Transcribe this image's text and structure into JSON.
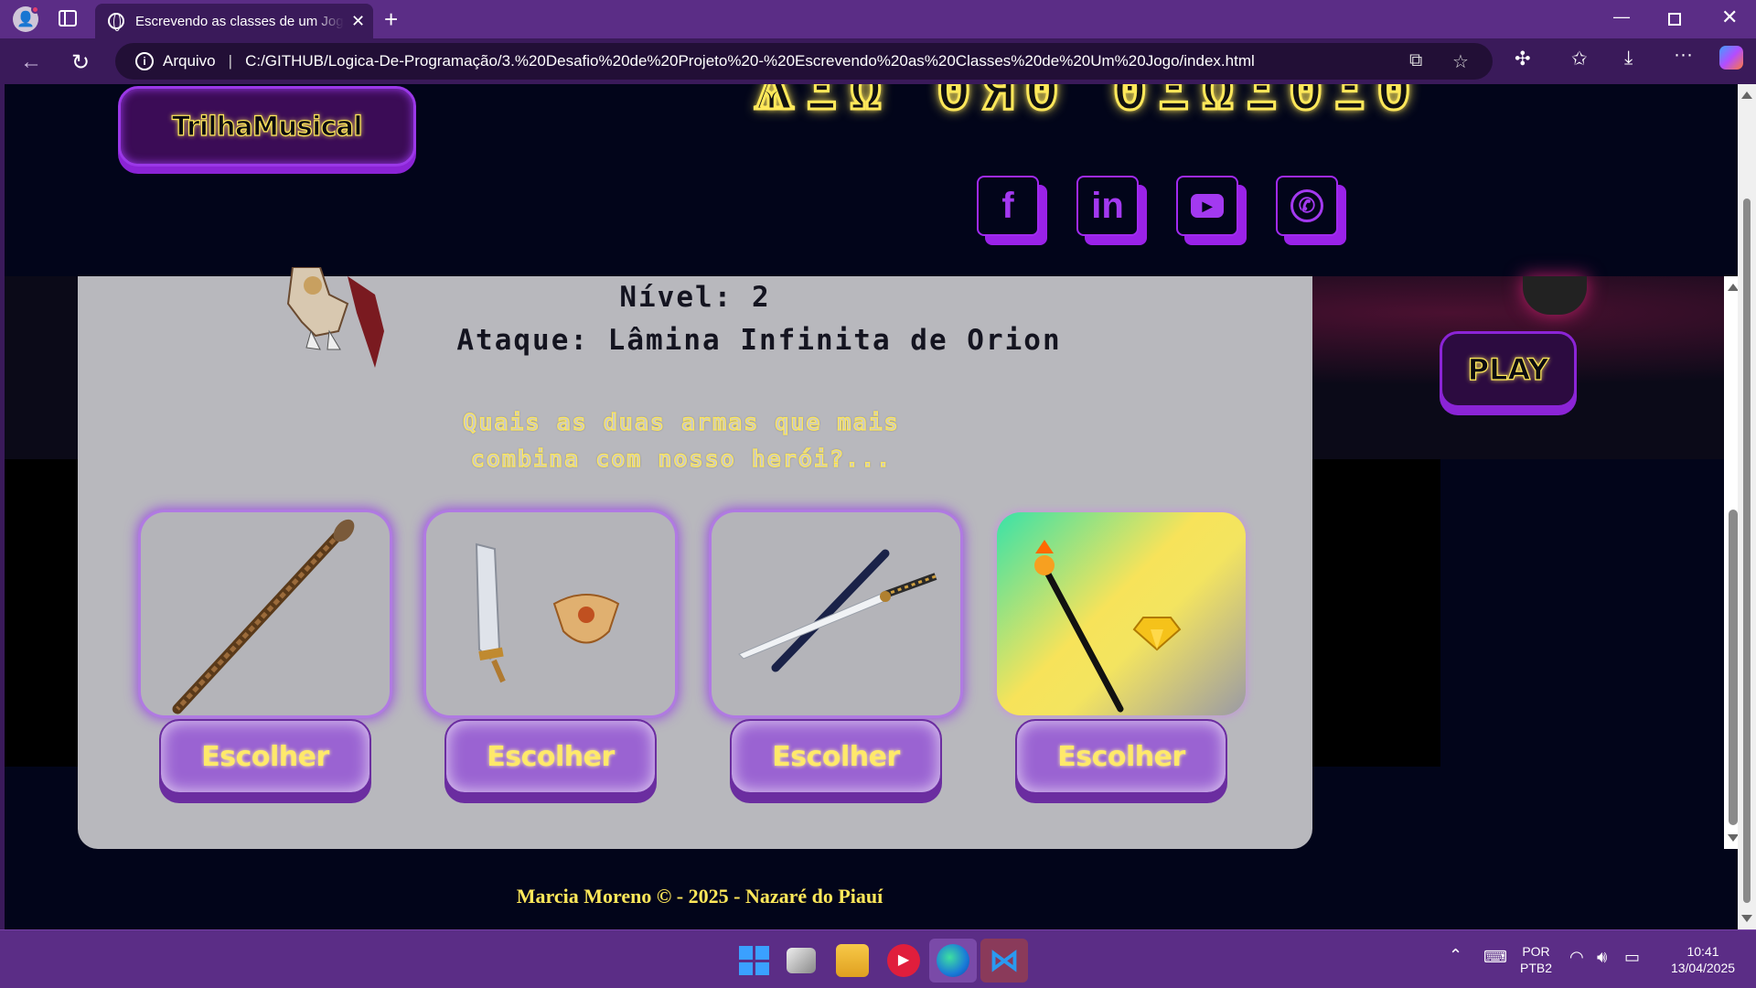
{
  "browser": {
    "tab_title": "Escrevendo as classes de um Jogo",
    "tab_close": "✕",
    "new_tab": "+",
    "address_scheme": "Arquivo",
    "address_url": "C:/GITHUB/Logica-De-Programação/3.%20Desafio%20de%20Projeto%20-%20Escrevendo%20as%20Classes%20de%20Um%20Jogo/index.html"
  },
  "page": {
    "music_button": "TrilhaMusical",
    "social": [
      {
        "name": "facebook",
        "glyph": "f"
      },
      {
        "name": "linkedin",
        "glyph": "in"
      },
      {
        "name": "youtube",
        "glyph": "▶"
      },
      {
        "name": "whatsapp",
        "glyph": "✆"
      }
    ],
    "play_button": "PLAY",
    "nivel": "Nível: 2",
    "ataque": "Ataque: Lâmina Infinita de Orion",
    "question": "Quais as duas armas que mais combina com nosso herói?...",
    "weapons": [
      {
        "name": "cajado",
        "button": "Escolher"
      },
      {
        "name": "espada-e-escudo",
        "button": "Escolher"
      },
      {
        "name": "katana",
        "button": "Escolher"
      },
      {
        "name": "cetro-e-diamante",
        "button": "Escolher"
      }
    ],
    "footer": "Marcia Moreno © - 2025 - Nazaré do Piauí"
  },
  "taskbar": {
    "language_top": "POR",
    "language_bottom": "PTB2",
    "time": "10:41",
    "date": "13/04/2025"
  },
  "colors": {
    "accent_purple": "#8b24d6",
    "neon_yellow": "#ffe85a",
    "chrome_purple": "#5b2d86"
  }
}
